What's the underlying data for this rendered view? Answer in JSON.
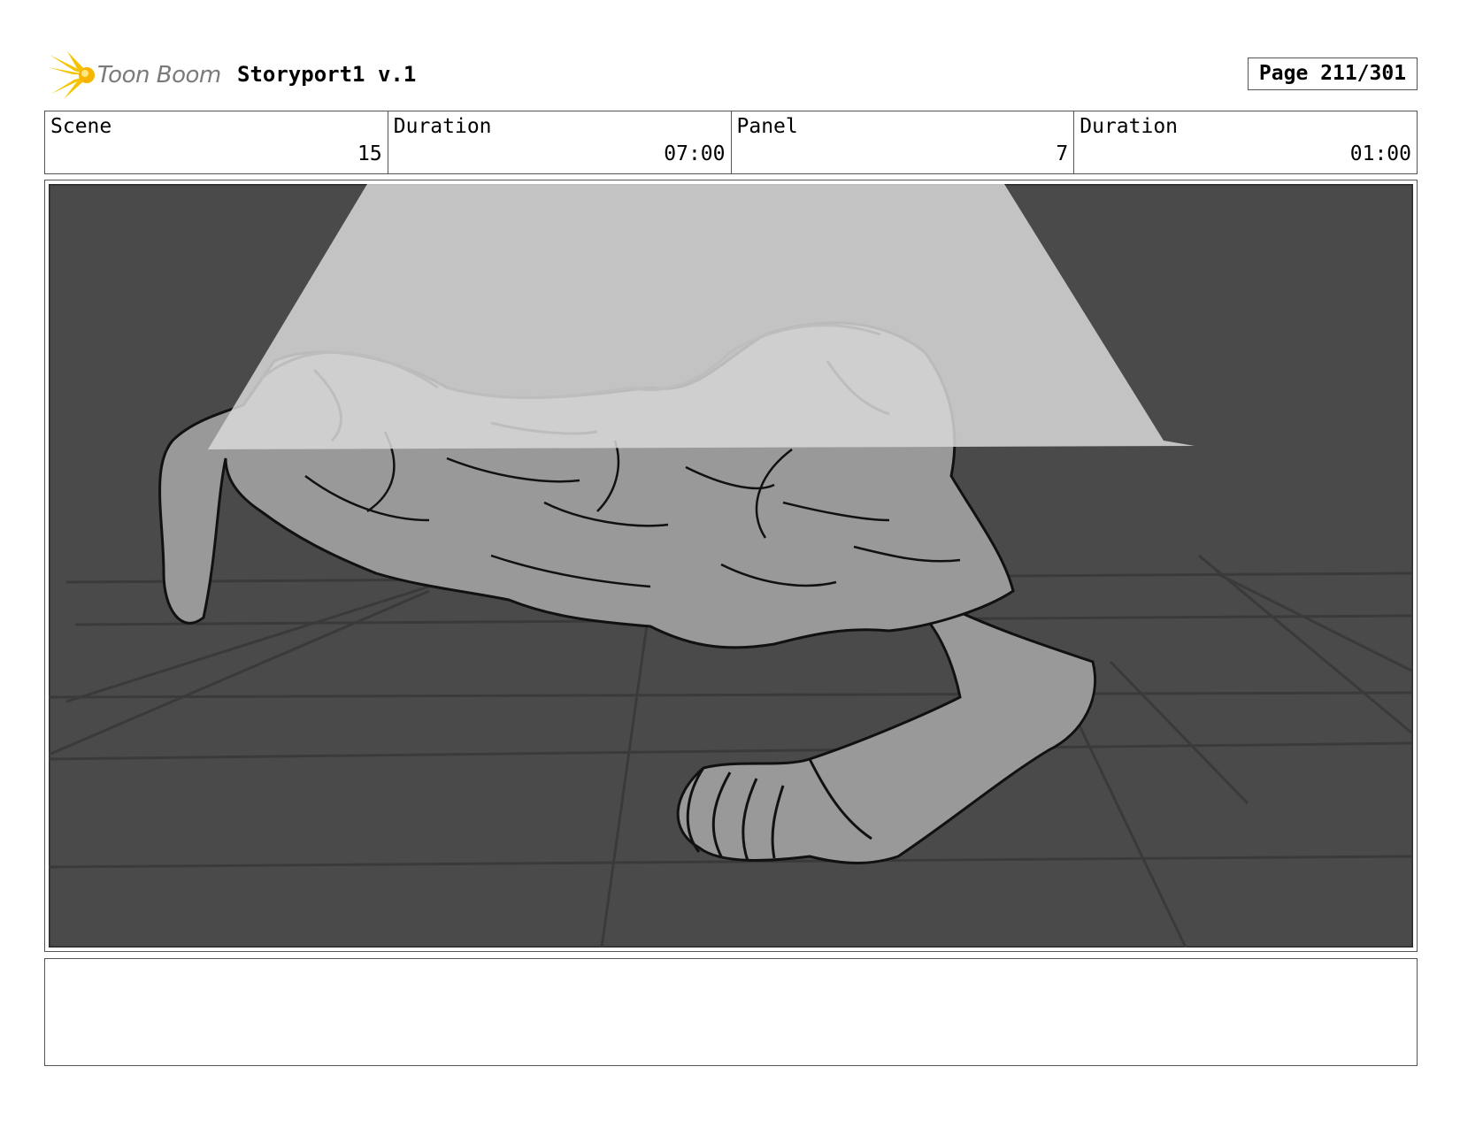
{
  "header": {
    "brand": "Toon Boom",
    "project_title": "Storyport1 v.1",
    "page_label": "Page 211/301"
  },
  "info": {
    "scene_label": "Scene",
    "scene_value": "15",
    "scene_duration_label": "Duration",
    "scene_duration_value": "07:00",
    "panel_label": "Panel",
    "panel_value": "7",
    "panel_duration_label": "Duration",
    "panel_duration_value": "01:00"
  },
  "panel": {
    "icon": "storyboard-sketch-image",
    "background_color": "#4a4a4a",
    "figure_color": "#999999",
    "light_color": "#d8d8d8"
  },
  "notes": {
    "text": ""
  }
}
